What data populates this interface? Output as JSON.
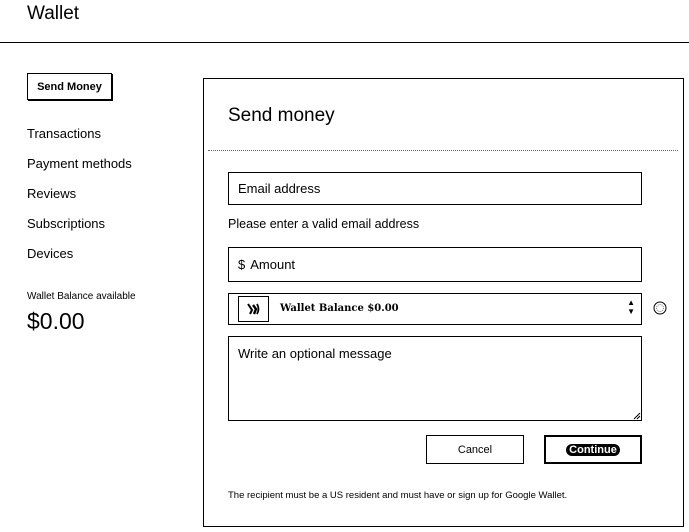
{
  "app": {
    "title": "Wallet"
  },
  "sidebar": {
    "send_button": "Send Money",
    "items": [
      {
        "label": "Transactions"
      },
      {
        "label": "Payment methods"
      },
      {
        "label": "Reviews"
      },
      {
        "label": "Subscriptions"
      },
      {
        "label": "Devices"
      }
    ],
    "balance_label": "Wallet Balance available",
    "balance_value": "$0.00"
  },
  "form": {
    "title": "Send money",
    "email_placeholder": "Email address",
    "email_error": "Please enter a valid email address",
    "amount_currency": "$",
    "amount_placeholder": "Amount",
    "funding_source": "Wallet Balance $0.00",
    "message_placeholder": "Write an optional message",
    "cancel_label": "Cancel",
    "continue_label": "Continue",
    "disclaimer": "The recipient must be a US resident and must have or sign up for Google Wallet."
  },
  "icons": {
    "wallet": "wallet-icon",
    "select_arrow": "updown-arrow-icon",
    "info": "info-icon",
    "resize": "resize-handle-icon"
  }
}
